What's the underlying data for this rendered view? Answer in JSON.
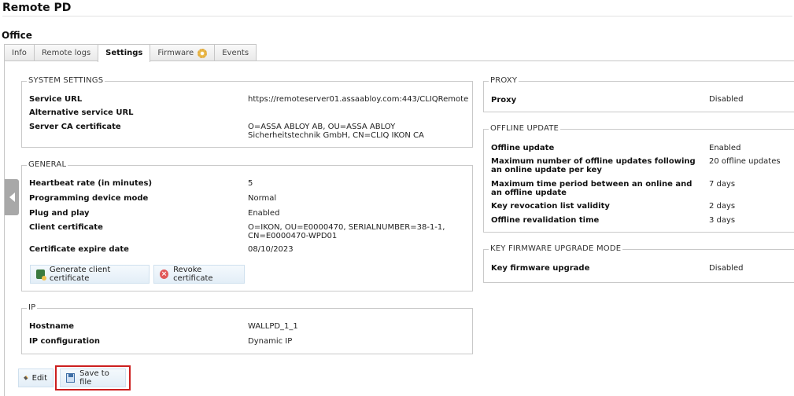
{
  "page": {
    "title": "Remote PD",
    "section": "Office"
  },
  "tabs": [
    "Info",
    "Remote logs",
    "Settings",
    "Firmware",
    "Events"
  ],
  "system_settings": {
    "legend": "SYSTEM SETTINGS",
    "rows": [
      {
        "label": "Service URL",
        "value": "https://remoteserver01.assaabloy.com:443/CLIQRemote"
      },
      {
        "label": "Alternative service URL",
        "value": ""
      },
      {
        "label": "Server CA certificate",
        "value": "O=ASSA ABLOY AB, OU=ASSA ABLOY Sicherheitstechnik GmbH, CN=CLIQ IKON CA"
      }
    ]
  },
  "general": {
    "legend": "GENERAL",
    "rows": [
      {
        "label": "Heartbeat rate (in minutes)",
        "value": "5"
      },
      {
        "label": "Programming device mode",
        "value": "Normal"
      },
      {
        "label": "Plug and play",
        "value": "Enabled"
      },
      {
        "label": "Client certificate",
        "value": "O=IKON, OU=E0000470, SERIALNUMBER=38-1-1, CN=E0000470-WPD01"
      },
      {
        "label": "Certificate expire date",
        "value": "08/10/2023"
      }
    ],
    "buttons": {
      "generate": "Generate client certificate",
      "revoke": "Revoke certificate"
    }
  },
  "ip": {
    "legend": "IP",
    "rows": [
      {
        "label": "Hostname",
        "value": "WALLPD_1_1"
      },
      {
        "label": "IP configuration",
        "value": "Dynamic IP"
      }
    ]
  },
  "proxy": {
    "legend": "PROXY",
    "rows": [
      {
        "label": "Proxy",
        "value": "Disabled"
      }
    ]
  },
  "offline_update": {
    "legend": "OFFLINE UPDATE",
    "rows": [
      {
        "label": "Offline update",
        "value": "Enabled"
      },
      {
        "label": "Maximum number of offline updates following an online update per key",
        "value": "20 offline updates"
      },
      {
        "label": "Maximum time period between an online and an offline update",
        "value": "7 days"
      },
      {
        "label": "Key revocation list validity",
        "value": "2 days"
      },
      {
        "label": "Offline revalidation time",
        "value": "3 days"
      }
    ]
  },
  "key_firmware": {
    "legend": "KEY FIRMWARE UPGRADE MODE",
    "rows": [
      {
        "label": "Key firmware upgrade",
        "value": "Disabled"
      }
    ]
  },
  "actions": {
    "edit": "Edit",
    "save": "Save to file"
  },
  "colors": {
    "highlight": "#cc1f1f",
    "button_bg": "#e3eef7"
  }
}
